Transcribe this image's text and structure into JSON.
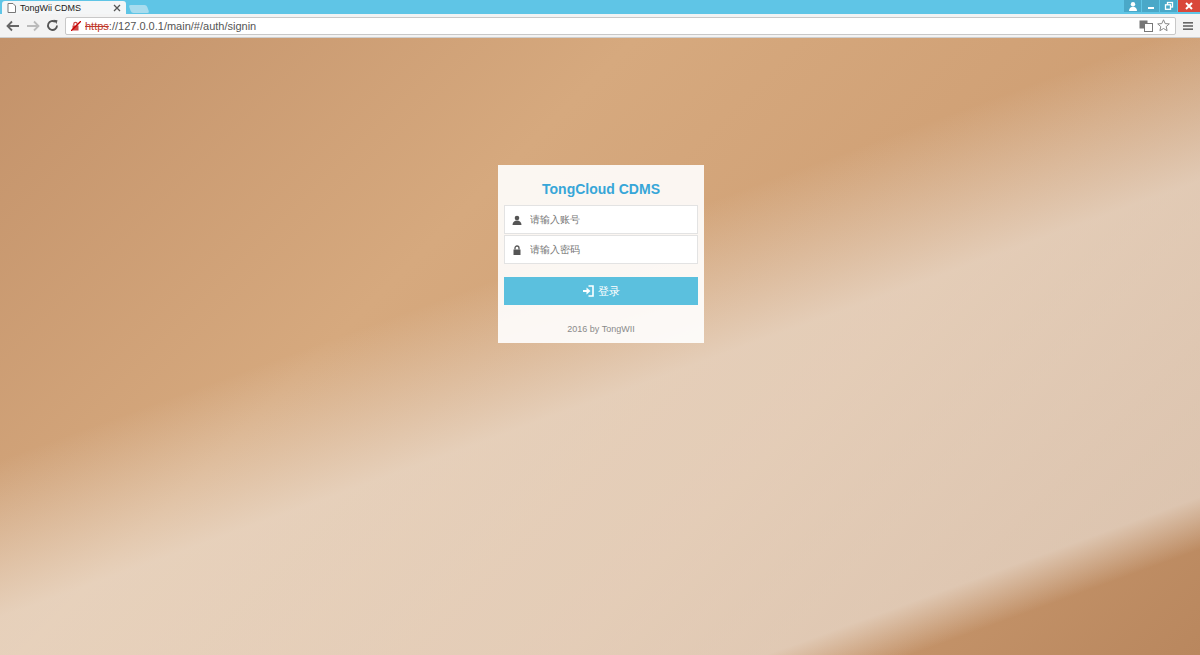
{
  "browser": {
    "tab_title": "TongWii CDMS",
    "url_scheme": "https",
    "url_rest": "://127.0.0.1/main/#/auth/signin",
    "scheme_insecure": true
  },
  "login": {
    "title": "TongCloud CDMS",
    "fields": [
      {
        "kind": "text",
        "placeholder": "请输入账号"
      },
      {
        "kind": "password",
        "placeholder": "请输入密码"
      }
    ],
    "button": "登录",
    "footer": "2016 by TongWII"
  }
}
